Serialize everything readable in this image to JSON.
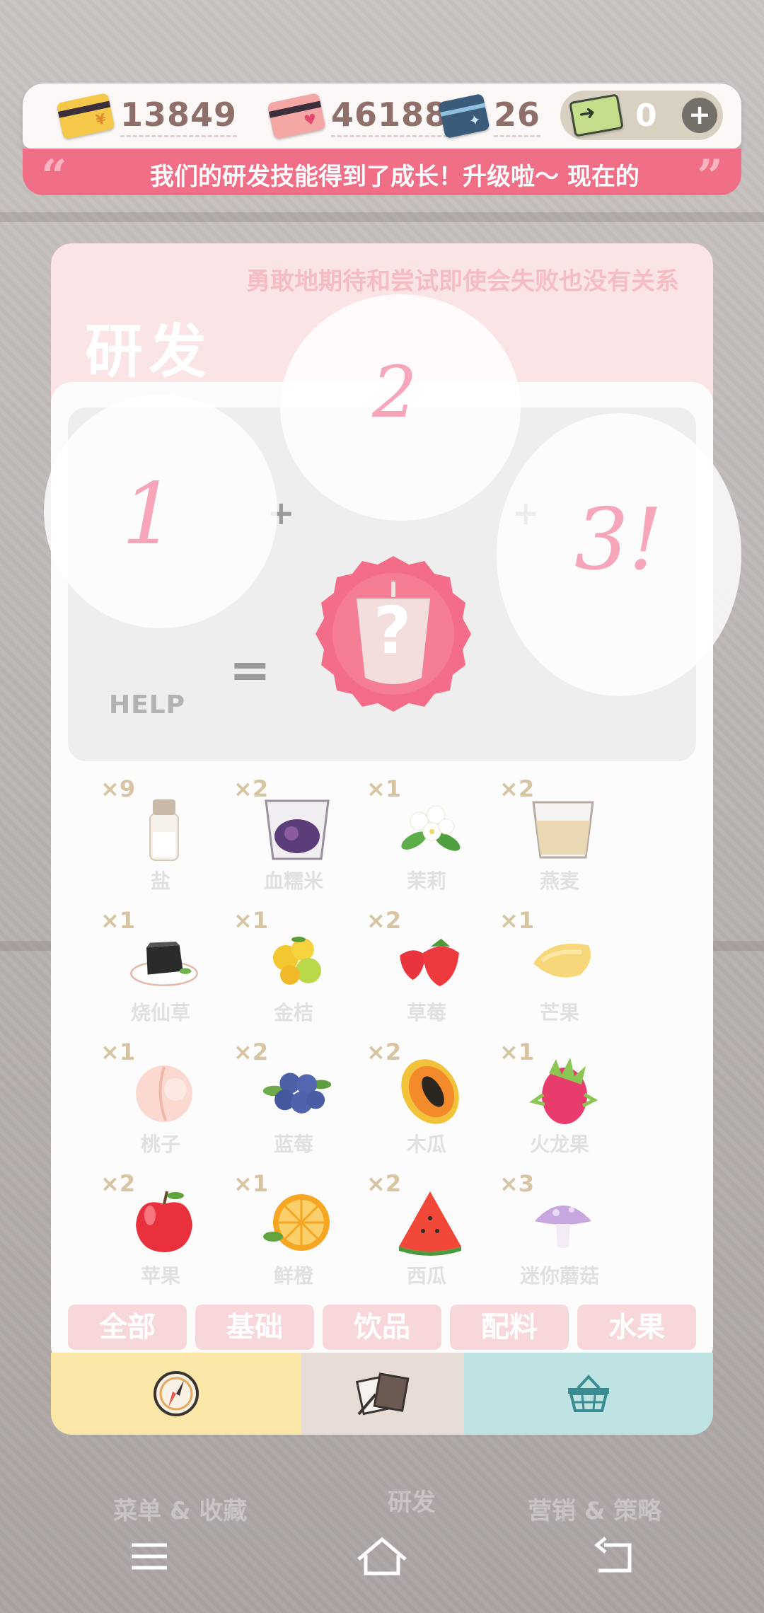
{
  "currencies": {
    "gold": {
      "value": "13849",
      "icon": "gold-card-icon",
      "color": "#f5c84a"
    },
    "heart": {
      "value": "46188",
      "icon": "heart-card-icon",
      "color": "#f4a7a4"
    },
    "research": {
      "value": "26",
      "icon": "research-card-icon",
      "color": "#3b5b7a"
    },
    "ticket": {
      "value": "0",
      "icon": "ticket-icon",
      "color": "#c4dd8a"
    }
  },
  "ticker": {
    "text": "我们的研发技能得到了成长！升级啦～ 现在的"
  },
  "panel": {
    "motto": "勇敢地期待和尝试即使会失败也没有关系",
    "title": "研发"
  },
  "slots": {
    "slot1": "1",
    "slot2": "2",
    "slot3": "3!",
    "plus": "+",
    "equals": "=",
    "result": "?",
    "help": "HELP"
  },
  "ingredients": [
    {
      "qty": "×9",
      "name": "盐",
      "icon": "salt-icon"
    },
    {
      "qty": "×2",
      "name": "血糯米",
      "icon": "black-rice-icon"
    },
    {
      "qty": "×1",
      "name": "茉莉",
      "icon": "jasmine-icon"
    },
    {
      "qty": "×2",
      "name": "燕麦",
      "icon": "oats-icon"
    },
    {
      "qty": "×1",
      "name": "烧仙草",
      "icon": "grass-jelly-icon"
    },
    {
      "qty": "×1",
      "name": "金桔",
      "icon": "kumquat-icon"
    },
    {
      "qty": "×2",
      "name": "草莓",
      "icon": "strawberry-icon"
    },
    {
      "qty": "×1",
      "name": "芒果",
      "icon": "mango-icon"
    },
    {
      "qty": "×1",
      "name": "桃子",
      "icon": "peach-icon"
    },
    {
      "qty": "×2",
      "name": "蓝莓",
      "icon": "blueberry-icon"
    },
    {
      "qty": "×2",
      "name": "木瓜",
      "icon": "papaya-icon"
    },
    {
      "qty": "×1",
      "name": "火龙果",
      "icon": "dragonfruit-icon"
    },
    {
      "qty": "×2",
      "name": "苹果",
      "icon": "apple-icon"
    },
    {
      "qty": "×1",
      "name": "鲜橙",
      "icon": "orange-icon"
    },
    {
      "qty": "×2",
      "name": "西瓜",
      "icon": "watermelon-icon"
    },
    {
      "qty": "×3",
      "name": "迷你蘑菇",
      "icon": "mushroom-icon"
    }
  ],
  "filters": [
    "全部",
    "基础",
    "饮品",
    "配料",
    "水果"
  ],
  "tabs": {
    "tab1_icon": "compass-icon",
    "tab2_icon": "recipe-notes-icon",
    "tab3_icon": "basket-icon"
  },
  "background_labels": {
    "left": "菜单 & 收藏",
    "center": "研发",
    "right": "营销 & 策略"
  },
  "accent_color": "#f06e86"
}
